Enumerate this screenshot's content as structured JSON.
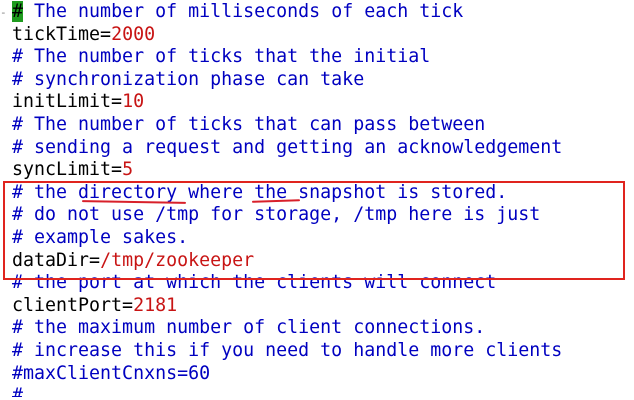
{
  "editor": {
    "gutter_mark": "-",
    "lines": [
      {
        "type": "comment",
        "prefix": "#",
        "text": " The number of milliseconds of each tick"
      },
      {
        "type": "kv",
        "key": "tickTime=",
        "value": "2000"
      },
      {
        "type": "comment",
        "text": "# The number of ticks that the initial"
      },
      {
        "type": "comment",
        "text": "# synchronization phase can take"
      },
      {
        "type": "kv",
        "key": "initLimit=",
        "value": "10"
      },
      {
        "type": "comment",
        "text": "# The number of ticks that can pass between"
      },
      {
        "type": "comment",
        "text": "# sending a request and getting an acknowledgement"
      },
      {
        "type": "kv",
        "key": "syncLimit=",
        "value": "5"
      },
      {
        "type": "comment",
        "text": "# the directory where the snapshot is stored."
      },
      {
        "type": "comment",
        "text": "# do not use /tmp for storage, /tmp here is just"
      },
      {
        "type": "comment",
        "text": "# example sakes."
      },
      {
        "type": "kv",
        "key": "dataDir=",
        "value": "/tmp/zookeeper"
      },
      {
        "type": "comment",
        "text": "# the port at which the clients will connect"
      },
      {
        "type": "kv",
        "key": "clientPort=",
        "value": "2181"
      },
      {
        "type": "comment",
        "text": "# the maximum number of client connections."
      },
      {
        "type": "comment",
        "text": "# increase this if you need to handle more clients"
      },
      {
        "type": "comment",
        "text": "#maxClientCnxns=60"
      },
      {
        "type": "comment",
        "text": "#"
      }
    ]
  },
  "colors": {
    "comment": "#0000c0",
    "value": "#c81414",
    "cursor": "#1e9b1e",
    "annotation": "#e0241e"
  }
}
